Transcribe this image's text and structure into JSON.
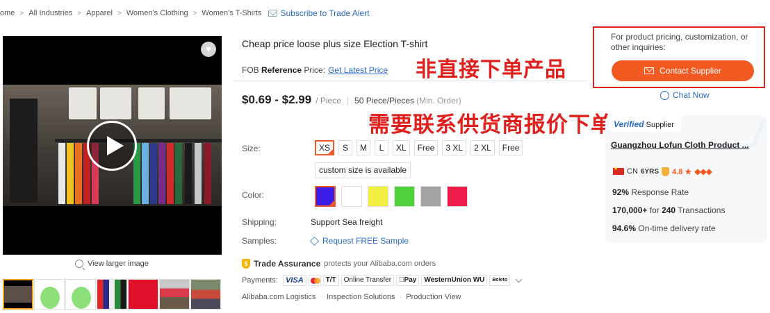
{
  "breadcrumb": {
    "items": [
      "ome",
      "All Industries",
      "Apparel",
      "Women's Clothing",
      "Women's T-Shirts"
    ],
    "subscribe": "Subscribe to Trade Alert"
  },
  "gallery": {
    "view_larger": "View larger image",
    "thumbnail_count": 7
  },
  "product": {
    "title": "Cheap price loose plus size Election T-shirt",
    "fob_prefix": "FOB ",
    "fob_bold": "Reference",
    "fob_suffix": " Price:",
    "fob_link": "Get Latest Price",
    "price_range": "$0.69 - $2.99",
    "price_unit": "/ Piece",
    "moq": "50 Piece/Pieces",
    "moq_note": "(Min. Order)"
  },
  "annotations": {
    "line1": "非直接下单产品",
    "line2": "需要联系供货商报价下单"
  },
  "options": {
    "size_label": "Size:",
    "sizes": [
      "XS",
      "S",
      "M",
      "L",
      "XL",
      "Free",
      "3 XL",
      "2 XL",
      "Free"
    ],
    "size_selected": "XS",
    "custom_size": "custom size is available",
    "color_label": "Color:",
    "colors": [
      "#3a1ee8",
      "#ffffff",
      "#f5ee42",
      "#4fcf3a",
      "#a3a3a3",
      "#f01c4a"
    ],
    "shipping_label": "Shipping:",
    "shipping_value": "Support Sea freight",
    "samples_label": "Samples:",
    "samples_link": "Request FREE Sample"
  },
  "trade": {
    "assurance": "Trade Assurance",
    "assurance_note": "protects your Alibaba.com orders",
    "payments_label": "Payments:",
    "methods": [
      "VISA",
      "T/T",
      "Online Transfer",
      "Pay",
      "WesternUnion WU",
      "Boleto"
    ],
    "services": [
      "Alibaba.com Logistics",
      "Inspection Solutions",
      "Production View"
    ]
  },
  "contact": {
    "question": "For product pricing, customization, or other inquiries:",
    "button": "Contact Supplier",
    "chat": "Chat Now"
  },
  "supplier": {
    "badge_v": "Verified",
    "badge_text": " Supplier",
    "name": "Guangzhou Lofun Cloth Product ...",
    "country": "CN",
    "years": "6YRS",
    "rating": "4.8 ★",
    "stats": [
      {
        "value": "92%",
        "text": " Response Rate"
      },
      {
        "value": "170,000+",
        "mid": " for ",
        "value2": "240",
        "text": " Transactions"
      },
      {
        "value": "94.6%",
        "text": " On-time delivery rate"
      }
    ]
  },
  "colors": {
    "accent": "#f25a22",
    "link": "#2a6ac7",
    "annotation": "#e0201c"
  }
}
